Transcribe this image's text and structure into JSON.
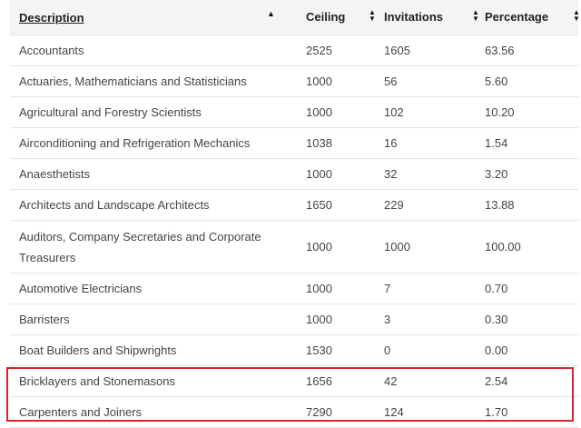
{
  "table": {
    "headers": {
      "description": "Description",
      "ceiling": "Ceiling",
      "invitations": "Invitations",
      "percentage": "Percentage"
    },
    "sort_icons": {
      "description": "sort-ascending-icon",
      "ceiling": "sort-both-icon",
      "invitations": "sort-both-icon",
      "percentage": "sort-both-icon"
    },
    "rows": [
      {
        "description": "Accountants",
        "ceiling": "2525",
        "invitations": "1605",
        "percentage": "63.56"
      },
      {
        "description": "Actuaries, Mathematicians and Statisticians",
        "ceiling": "1000",
        "invitations": "56",
        "percentage": "5.60"
      },
      {
        "description": "Agricultural and Forestry Scientists",
        "ceiling": "1000",
        "invitations": "102",
        "percentage": "10.20"
      },
      {
        "description": "Airconditioning and Refrigeration Mechanics",
        "ceiling": "1038",
        "invitations": "16",
        "percentage": "1.54"
      },
      {
        "description": "Anaesthetists",
        "ceiling": "1000",
        "invitations": "32",
        "percentage": "3.20"
      },
      {
        "description": "Architects and Landscape Architects",
        "ceiling": "1650",
        "invitations": "229",
        "percentage": "13.88"
      },
      {
        "description": "Auditors, Company Secretaries and Corporate Treasurers",
        "ceiling": "1000",
        "invitations": "1000",
        "percentage": "100.00"
      },
      {
        "description": "Automotive Electricians",
        "ceiling": "1000",
        "invitations": "7",
        "percentage": "0.70"
      },
      {
        "description": "Barristers",
        "ceiling": "1000",
        "invitations": "3",
        "percentage": "0.30"
      },
      {
        "description": "Boat Builders and Shipwrights",
        "ceiling": "1530",
        "invitations": "0",
        "percentage": "0.00"
      },
      {
        "description": "Bricklayers and Stonemasons",
        "ceiling": "1656",
        "invitations": "42",
        "percentage": "2.54"
      },
      {
        "description": "Carpenters and Joiners",
        "ceiling": "7290",
        "invitations": "124",
        "percentage": "1.70"
      }
    ]
  },
  "highlight_color": "#d9232e"
}
